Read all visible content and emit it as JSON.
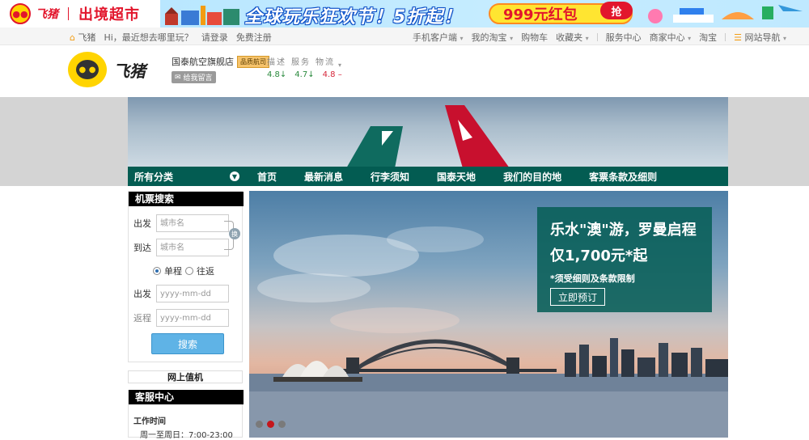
{
  "promo": {
    "brand_name": "飞猪",
    "brand_sub": "出境超市",
    "headline": "全球玩乐狂欢节！5折起！",
    "coupon": "999元红包",
    "grab": "抢"
  },
  "topnav": {
    "home": "飞猪",
    "greeting": "Hi，最近想去哪里玩？",
    "login": "请登录",
    "register": "免费注册",
    "right": [
      "手机客户端",
      "我的淘宝",
      "购物车",
      "收藏夹",
      "服务中心",
      "商家中心",
      "淘宝",
      "网站导航"
    ]
  },
  "shop": {
    "logo_text": "飞猪",
    "store_name": "国泰航空旗舰店",
    "badge": "品质航司",
    "msg": "给我留言",
    "rating_labels": [
      "描述",
      "服务",
      "物流"
    ],
    "rating_values": [
      "4.8",
      "4.7",
      "4.8"
    ],
    "rating_trends": [
      "↓",
      "↓",
      "–"
    ]
  },
  "catbar": {
    "all": "所有分类",
    "items": [
      "首页",
      "最新消息",
      "行李须知",
      "国泰天地",
      "我们的目的地",
      "客票条款及细则"
    ]
  },
  "search": {
    "title": "机票搜索",
    "depart_label": "出发",
    "arrive_label": "到达",
    "city_placeholder": "城市名",
    "swap": "换",
    "oneway": "单程",
    "roundtrip": "往返",
    "depart_date_label": "出发",
    "return_date_label": "返程",
    "date_placeholder": "yyyy-mm-dd",
    "button": "搜索"
  },
  "checkin": "网上值机",
  "service": {
    "title": "客服中心",
    "hours_title": "工作时间",
    "hours": "周一至周日：7:00-23:00"
  },
  "banner": {
    "title": "乐水\"澳\"游，罗曼启程",
    "price": "仅1,700元*起",
    "note": "*须受细则及条款限制",
    "button": "立即预订",
    "active_slide": 2,
    "slide_count": 3
  },
  "colors": {
    "teal": "#035c52",
    "brand_red": "#e2162c",
    "button_blue": "#5fb3e6"
  }
}
